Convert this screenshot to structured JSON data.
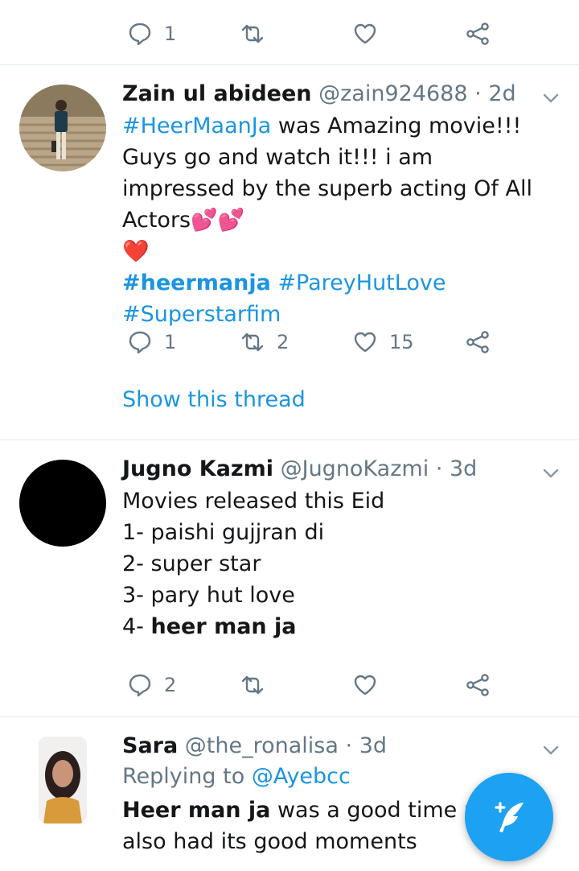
{
  "top_actions": {
    "reply_count": "1"
  },
  "tweets": [
    {
      "name": "Zain ul abideen",
      "handle": "@zain924688",
      "dot": "·",
      "time": "2d",
      "text_tag1": "#HeerMaanJa",
      "text_rest": " was Amazing movie!!! Guys go and watch it!!!  i am impressed by the superb acting Of All Actors💕💕",
      "text_heart": "❤️",
      "tags": [
        "#heermanja",
        "#PareyHutLove",
        "#Superstarfim"
      ],
      "reply_count": "1",
      "retweet_count": "2",
      "like_count": "15",
      "show_thread": "Show this thread"
    },
    {
      "name": "Jugno Kazmi",
      "handle": "@JugnoKazmi",
      "dot": "·",
      "time": "3d",
      "lines": [
        "Movies released this Eid",
        "1- paishi gujjran di",
        "2- super star",
        "3- pary hut love"
      ],
      "line4_prefix": "4- ",
      "line4_bold": "heer man ja",
      "reply_count": "2"
    },
    {
      "name": "Sara",
      "handle": "@the_ronalisa",
      "dot": "·",
      "time": "3d",
      "replying_to_label": "Replying to",
      "replying_to_handle": "@Ayebcc",
      "text_bold": "Heer man ja",
      "text_rest": " was a good time pa",
      "text_line2": "also had its good moments"
    }
  ],
  "colors": {
    "accent": "#1da1f2",
    "link": "#1b95e0",
    "muted": "#657786",
    "divider": "#e1e8ed"
  }
}
